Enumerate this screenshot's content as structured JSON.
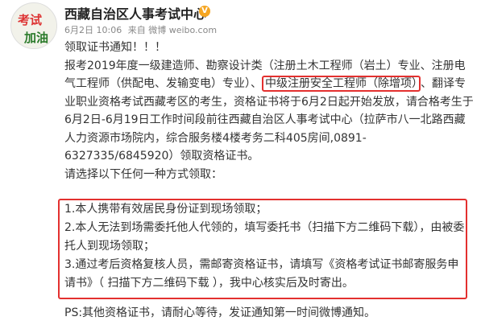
{
  "account": {
    "avatar_text_top": "考试",
    "avatar_text_bottom": "加油",
    "name": "西藏自治区人事考试中心",
    "verified_mark": "V",
    "date": "6月2日 10:06",
    "source_prefix": "来自",
    "source": "微博 weibo.com"
  },
  "post": {
    "title": "领取证书通知！！！",
    "para1_a": "报考2019年度一级建造师、勘察设计类（注册土木工程师（岩土）专业、注册电气工程师（供配电、发输变电）专业）、",
    "para1_highlight": "中级注册安全工程师（除增项）",
    "para1_b": "、翻译专业职业资格考试西藏考区的考生，资格证书将于6月2日起开始发放，请合格考生于6月2日-6月19日工作时间段前往西藏自治区人事考试中心（拉萨市八一北路西藏人力资源市场院内，综合服务楼4楼考务二科405房间,0891-6327335/6845920）领取资格证书。",
    "choose": "请选择以下任何一种方式领取：",
    "option1": "1.本人携带有效居民身份证到现场领取；",
    "option2": "2.本人无法到场需委托他人代领的，填写委托书（扫描下方二维码下载），由被委托人到现场领取；",
    "option3": "3.通过考后资格复核人员，需邮寄资格证书，请填写《资格考试证书邮寄服务申请书》（ 扫描下方二维码下载 ），我中心核实后及时寄出。",
    "ps": "PS:其他资格证书，请耐心等待，发证通知第一时间微博通知。"
  },
  "colors": {
    "highlight_border": "#e3302f",
    "verified_badge": "#f5a623"
  }
}
